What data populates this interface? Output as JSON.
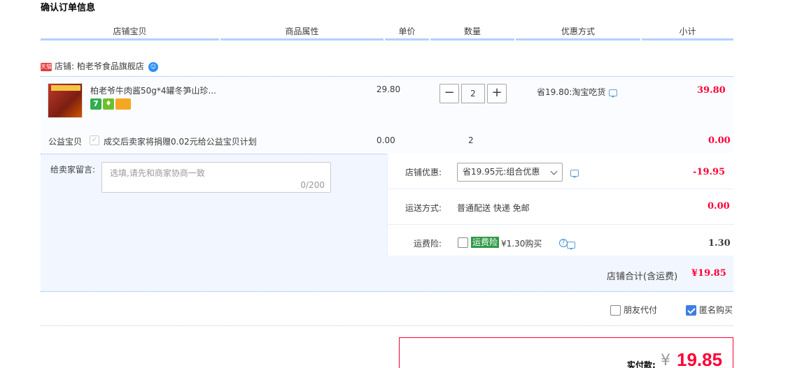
{
  "page_title": "确认订单信息",
  "columns": [
    "店铺宝贝",
    "商品属性",
    "单价",
    "数量",
    "优惠方式",
    "小计"
  ],
  "shop": {
    "badge": "天猫",
    "label": "店铺: 柏老爷食品旗舰店",
    "chat_icon": "wangwang-icon"
  },
  "item": {
    "title": "柏老爷牛肉酱50g*4罐冬笋山珍...",
    "service_icons": [
      "seven-day-return-icon",
      "guarantee-icon",
      "card-payment-icon"
    ],
    "unit_price": "29.80",
    "quantity": "2",
    "promo": "省19.80:淘宝吃货",
    "subtotal": "39.80"
  },
  "charity": {
    "label": "公益宝贝",
    "text": "成交后卖家将捐赠0.02元给公益宝贝计划",
    "price": "0.00",
    "quantity": "2",
    "subtotal": "0.00"
  },
  "message": {
    "label": "给卖家留言:",
    "placeholder": "选填,请先和商家协商一致",
    "count": "0/200"
  },
  "shop_discount": {
    "label": "店铺优惠:",
    "selected": "省19.95元:组合优惠",
    "amount": "-19.95"
  },
  "shipping": {
    "label": "运送方式:",
    "value": "普通配送 快递 免邮",
    "amount": "0.00"
  },
  "insurance": {
    "label": "运费险:",
    "tag": "运费险",
    "price": "¥1.30购买",
    "amount": "1.30"
  },
  "shop_total": {
    "label": "店铺合计(含运费)",
    "amount": "¥19.85"
  },
  "options": {
    "friend_pay": "朋友代付",
    "anonymous": "匿名购买"
  },
  "payment": {
    "label": "实付款:",
    "currency": "¥",
    "amount": "19.85"
  },
  "colors": {
    "accent_red": "#ff0036",
    "header_line": "#b2d1ff",
    "panel_bg": "#f2f7ff",
    "insurance_green": "#2e9a46"
  }
}
